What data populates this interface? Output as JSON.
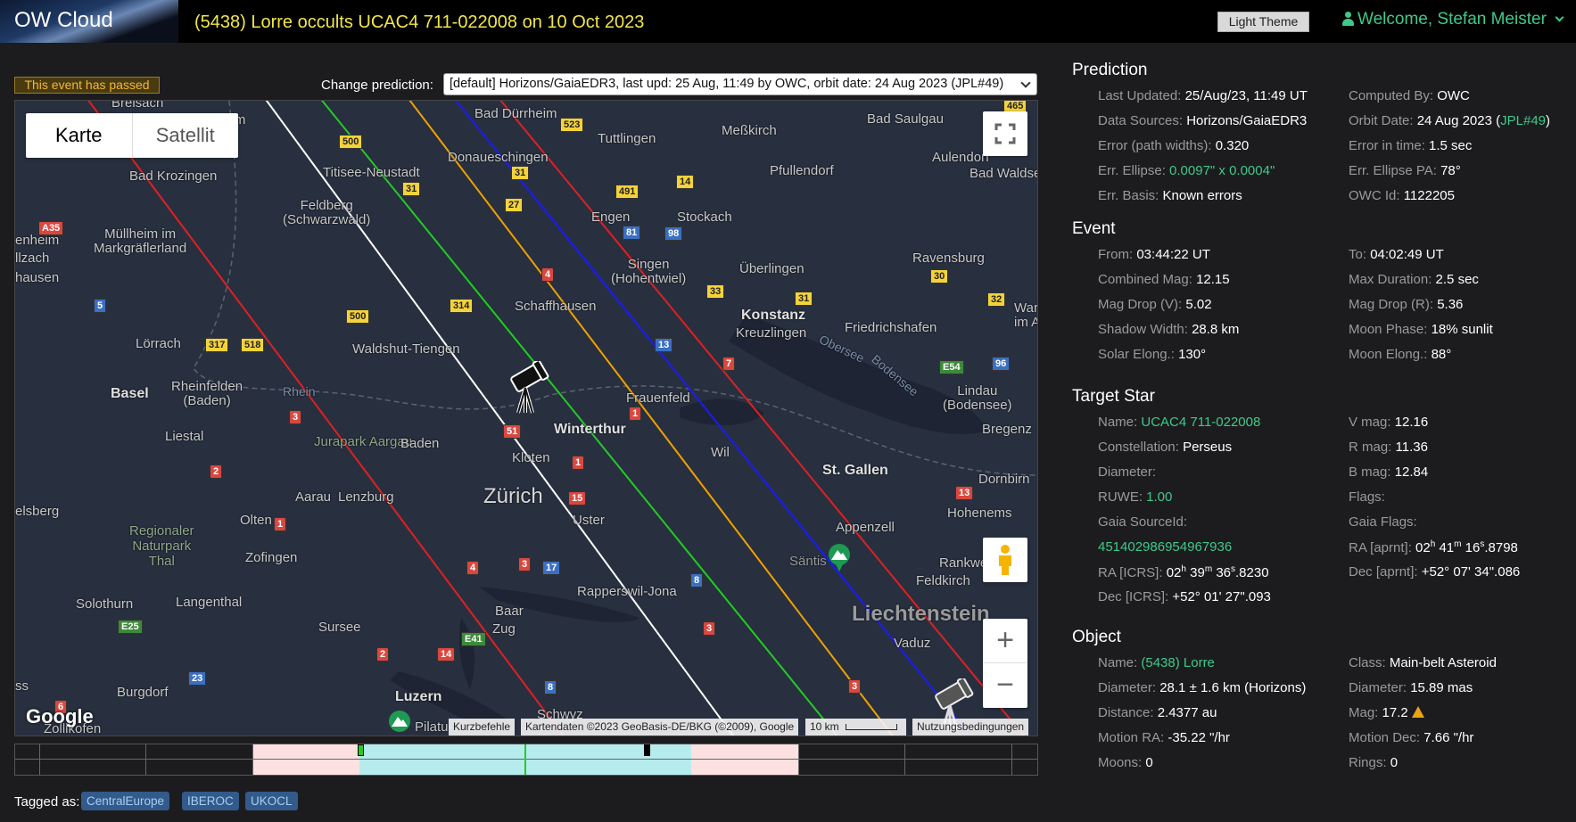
{
  "header": {
    "logo": "OW Cloud",
    "event_title": "(5438) Lorre occults UCAC4 711-022008 on 10 Oct 2023",
    "theme_button": "Light Theme",
    "welcome": "Welcome, Stefan Meister"
  },
  "toolbar": {
    "passed_badge": "This event has passed",
    "change_label": "Change prediction:",
    "prediction_selected": "[default] Horizons/GaiaEDR3, last upd: 25 Aug, 11:49 by OWC, orbit date: 24 Aug 2023 (JPL#49)"
  },
  "map": {
    "map_type_map": "Karte",
    "map_type_satellite": "Satellit",
    "google_logo": "Google",
    "attrib_shortcuts": "Kurzbefehle",
    "attrib_data": "Kartendaten ©2023 GeoBasis-DE/BKG (©2009), Google",
    "attrib_scale": "10 km",
    "attrib_terms": "Nutzungsbedingungen",
    "places": {
      "breisach": "Breisach",
      "bad_durrheim": "Bad Dürrheim",
      "tuttlingen": "Tuttlingen",
      "messkirch": "Meßkirch",
      "bad_saulgau": "Bad Saulgau",
      "aulendorf": "Aulendorf",
      "bad_waldsee": "Bad Waldse",
      "donaueschingen": "Donaueschingen",
      "pfullendorf": "Pfullendorf",
      "bad_krozingen": "Bad Krozingen",
      "titisee": "Titisee-Neustadt",
      "feldberg": "Feldberg\n(Schwarzwald)",
      "engen": "Engen",
      "stockach": "Stockach",
      "muellheim": "Müllheim im\nMarkgräflerland",
      "ravensburg": "Ravensburg",
      "singen": "Singen\n(Hohentwiel)",
      "ueberlingen": "Überlingen",
      "schaffhausen": "Schaffhausen",
      "konstanz": "Konstanz",
      "kreuzlingen": "Kreuzlingen",
      "friedrichshafen": "Friedrichshafen",
      "loerrach": "Lörrach",
      "waldshut": "Waldshut-Tiengen",
      "basel": "Basel",
      "rheinfelden": "Rheinfelden\n(Baden)",
      "frauenfeld": "Frauenfeld",
      "lindau": "Lindau\n(Bodensee)",
      "bregenz": "Bregenz",
      "winterthur": "Winterthur",
      "liestal": "Liestal",
      "jurapark": "Jurapark\nAargau",
      "baden": "Baden",
      "kloten": "Kloten",
      "wil": "Wil",
      "stgallen": "St. Gallen",
      "dornbirn": "Dornbirn",
      "zurich": "Zürich",
      "aarau": "Aarau",
      "lenzburg": "Lenzburg",
      "hohenems": "Hohenems",
      "olten": "Olten",
      "uster": "Uster",
      "appenzell": "Appenzell",
      "regionaler": "Regionaler\nNaturpark\nThal",
      "zofingen": "Zofingen",
      "saentis": "Säntis",
      "rankweil": "Rankwe",
      "feldkirch": "Feldkirch",
      "rapperswil": "Rapperswil-Jona",
      "liechtenstein": "Liechtenstein",
      "solothurn": "Solothurn",
      "langenthal": "Langenthal",
      "baar": "Baar",
      "zug": "Zug",
      "sursee": "Sursee",
      "vaduz": "Vaduz",
      "burgdorf": "Burgdorf",
      "luzern": "Luzern",
      "schwyz": "Schwyz",
      "pilatus": "Pilatu",
      "zollikofen": "Zollikofen",
      "bodensee": "Bodensee",
      "obersee": "Obersee",
      "hausen": "hausen",
      "enheim": "enheim",
      "llzach": "llzach",
      "elsberg": "elsberg",
      "ss": "ss",
      "rhein": "Rhein",
      "war": "War\nim A",
      "gim": "g im"
    },
    "roads": {
      "r465": "465",
      "r523": "523",
      "r500a": "500",
      "r31a": "31",
      "r31b": "31",
      "r491": "491",
      "r14": "14",
      "r27": "27",
      "r81": "81",
      "r98": "98",
      "a35": "A35",
      "r4a": "4",
      "r33": "33",
      "r31c": "31",
      "r30": "30",
      "r32": "32",
      "r5": "5",
      "r314": "314",
      "r500b": "500",
      "r317": "317",
      "r518": "518",
      "r13": "13",
      "r7": "7",
      "e54": "E54",
      "r96": "96",
      "r3a": "3",
      "r1a": "1",
      "r51": "51",
      "r1b": "1",
      "r2": "2",
      "r15": "15",
      "r13b": "13",
      "r1c": "1",
      "r4b": "4",
      "r3b": "3",
      "r17": "17",
      "r8a": "8",
      "e25": "E25",
      "e41": "E41",
      "r3c": "3",
      "r2b": "2",
      "r14b": "14",
      "r23": "23",
      "r8b": "8",
      "r6": "6",
      "r3d": "3"
    }
  },
  "timeline": {},
  "tags": {
    "label": "Tagged as:",
    "items": [
      "CentralEurope",
      "IBEROC",
      "UKOCL"
    ]
  },
  "prediction": {
    "title": "Prediction",
    "last_updated_k": "Last Updated:",
    "last_updated_v": "25/Aug/23, 11:49 UT",
    "computed_by_k": "Computed By:",
    "computed_by_v": "OWC",
    "data_sources_k": "Data Sources:",
    "data_sources_v": "Horizons/GaiaEDR3",
    "orbit_date_k": "Orbit Date:",
    "orbit_date_v": "24 Aug 2023 (",
    "orbit_jpl": "JPL#49",
    "orbit_close": ")",
    "error_pw_k": "Error (path widths):",
    "error_pw_v": "0.320",
    "error_time_k": "Error in time:",
    "error_time_v": "1.5 sec",
    "err_ellipse_k": "Err. Ellipse:",
    "err_ellipse_v": "0.0097\" x 0.0004\"",
    "err_pa_k": "Err. Ellipse PA:",
    "err_pa_v": "78°",
    "err_basis_k": "Err. Basis:",
    "err_basis_v": "Known errors",
    "owc_id_k": "OWC Id:",
    "owc_id_v": "1122205"
  },
  "event": {
    "title": "Event",
    "from_k": "From:",
    "from_v": "03:44:22 UT",
    "to_k": "To:",
    "to_v": "04:02:49 UT",
    "cmag_k": "Combined Mag:",
    "cmag_v": "12.15",
    "maxdur_k": "Max Duration:",
    "maxdur_v": "2.5 sec",
    "mdv_k": "Mag Drop (V):",
    "mdv_v": "5.02",
    "mdr_k": "Mag Drop (R):",
    "mdr_v": "5.36",
    "sw_k": "Shadow Width:",
    "sw_v": "28.8 km",
    "mphase_k": "Moon Phase:",
    "mphase_v": "18% sunlit",
    "selong_k": "Solar Elong.:",
    "selong_v": "130°",
    "melong_k": "Moon Elong.:",
    "melong_v": "88°"
  },
  "star": {
    "title": "Target Star",
    "name_k": "Name:",
    "name_v": "UCAC4 711-022008",
    "vmag_k": "V mag:",
    "vmag_v": "12.16",
    "const_k": "Constellation:",
    "const_v": "Perseus",
    "rmag_k": "R mag:",
    "rmag_v": "11.36",
    "diam_k": "Diameter:",
    "bmag_k": "B mag:",
    "bmag_v": "12.84",
    "ruwe_k": "RUWE:",
    "ruwe_v": "1.00",
    "flags_k": "Flags:",
    "gaia_id_k": "Gaia SourceId:",
    "gaia_flags_k": "Gaia Flags:",
    "gaia_id_v": "451402986954967936",
    "ra_aprnt_k": "RA [aprnt]:",
    "ra_aprnt_h": "02",
    "ra_aprnt_m": "41",
    "ra_aprnt_s": "16",
    "ra_aprnt_f": ".8798",
    "ra_icrs_k": "RA [ICRS]:",
    "ra_icrs_h": "02",
    "ra_icrs_m": "39",
    "ra_icrs_s": "36",
    "ra_icrs_f": ".8230",
    "dec_aprnt_k": "Dec [aprnt]:",
    "dec_aprnt_v": "+52° 07' 34\".086",
    "dec_icrs_k": "Dec [ICRS]:",
    "dec_icrs_v": "+52° 01' 27\".093"
  },
  "object": {
    "title": "Object",
    "name_k": "Name:",
    "name_v": "(5438) Lorre",
    "class_k": "Class:",
    "class_v": "Main-belt Asteroid",
    "diam_k": "Diameter:",
    "diam_v": "28.1 ± 1.6 km",
    "diam_src": "(Horizons)",
    "diam2_k": "Diameter:",
    "diam2_v": "15.89 mas",
    "dist_k": "Distance:",
    "dist_v": "2.4377 au",
    "mag_k": "Mag:",
    "mag_v": "17.2",
    "mra_k": "Motion RA:",
    "mra_v": "-35.22 \"/hr",
    "mdec_k": "Motion Dec:",
    "mdec_v": "7.66 \"/hr",
    "moons_k": "Moons:",
    "moons_v": "0",
    "rings_k": "Rings:",
    "rings_v": "0"
  },
  "colors": {
    "accent_green": "#3fc98a",
    "title_yellow": "#f2e64a",
    "path_red": "#e02020",
    "path_orange": "#f0a000",
    "path_green": "#22cc22",
    "path_blue": "#1a1aff",
    "centerline_white": "#ffffff"
  }
}
